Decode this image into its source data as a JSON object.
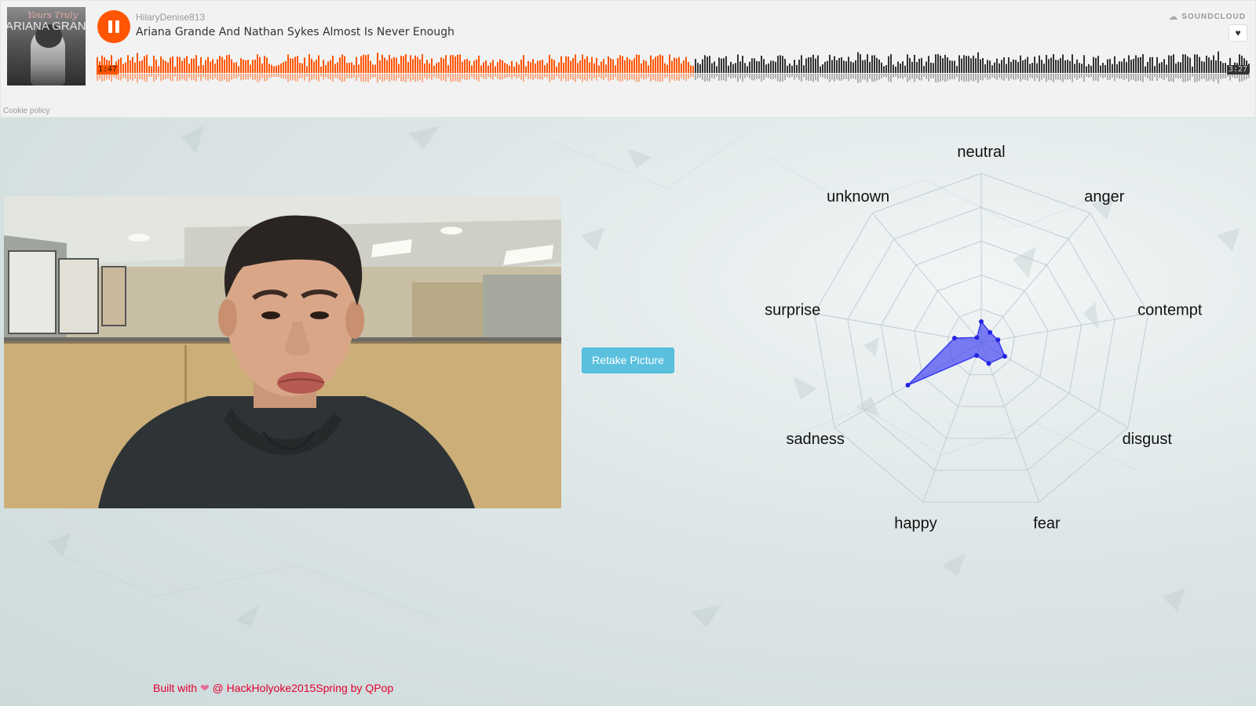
{
  "player": {
    "username": "HilaryDenise813",
    "track_title": "Ariana Grande And Nathan Sykes Almost Is Never Enough",
    "current_time": "1:47",
    "total_time": "3:27",
    "progress": 0.5169,
    "brand_label": "SOUNDCLOUD",
    "cookie_label": "Cookie policy",
    "album_art": {
      "script_text": "Yours Truly",
      "artist_text": "ARIANA GRANDE"
    },
    "colors": {
      "accent": "#ff5500",
      "played": "#ff5500",
      "unplayed": "#333333"
    },
    "icons": {
      "play_state": "pause-icon",
      "like": "heart-icon",
      "brand": "cloud-icon"
    }
  },
  "actions": {
    "retake_label": "Retake Picture"
  },
  "chart_data": {
    "type": "radar",
    "axes": [
      "neutral",
      "anger",
      "contempt",
      "disgust",
      "fear",
      "happy",
      "sadness",
      "surprise",
      "unknown"
    ],
    "values": [
      0.125,
      0.08,
      0.1,
      0.16,
      0.13,
      0.08,
      0.5,
      0.16,
      0.04
    ],
    "range": [
      0,
      1
    ],
    "grid_levels": 5,
    "series_color": "#3a3af2"
  },
  "footer": {
    "prefix": "Built with",
    "heart": "❤",
    "suffix": "@ HackHolyoke2015Spring by QPop"
  }
}
